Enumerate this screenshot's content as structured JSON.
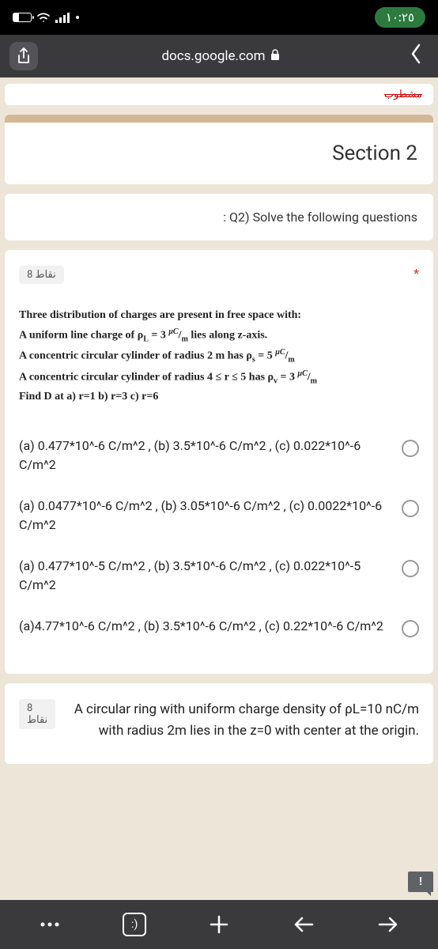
{
  "status": {
    "time": "١٠:٢٥"
  },
  "browser": {
    "url": "docs.google.com"
  },
  "topStrip": {
    "cutoff": "مشطوب"
  },
  "section": {
    "title": "Section 2"
  },
  "instruction": {
    "text": ": Q2) Solve the following questions"
  },
  "q1": {
    "points": "8 نقاط",
    "asterisk": "*",
    "intro": "Three distribution of charges are present in free space with:",
    "line1a": "A uniform line charge of ρ",
    "line1sub": "L",
    "line1b": " = 3 ",
    "line1sup": "μC",
    "line1c": "/",
    "line1sub2": "m",
    "line1d": " lies along z-axis.",
    "line2a": "A concentric circular cylinder of radius 2 m has ρ",
    "line2sub": "s",
    "line2b": " = 5 ",
    "line2sup": "μC",
    "line2c": "/",
    "line2sub2": "m",
    "line3a": "A concentric circular cylinder of radius 4 ≤ r ≤ 5 has ρ",
    "line3sub": "v",
    "line3b": " = 3 ",
    "line3sup": "μC",
    "line3c": "/",
    "line3sub2": "m",
    "line4": "Find D at a) r=1   b) r=3   c) r=6",
    "opt1": "(a) 0.477*10^-6 C/m^2 , (b) 3.5*10^-6 C/m^2 , (c) 0.022*10^-6 C/m^2",
    "opt2": "(a) 0.0477*10^-6 C/m^2 , (b) 3.05*10^-6 C/m^2 , (c) 0.0022*10^-6 C/m^2",
    "opt3": "(a) 0.477*10^-5 C/m^2 , (b) 3.5*10^-6 C/m^2 , (c) 0.022*10^-5 C/m^2",
    "opt4": "(a)4.77*10^-6 C/m^2 , (b) 3.5*10^-6 C/m^2 , (c) 0.22*10^-6 C/m^2"
  },
  "q2": {
    "points": "8 نقاط",
    "text": "A circular ring with uniform charge density of ρL=10 nC/m with radius 2m lies in the z=0 with center at the origin."
  },
  "feedback": {
    "icon": "!"
  },
  "nav": {
    "smiley": ":)"
  }
}
